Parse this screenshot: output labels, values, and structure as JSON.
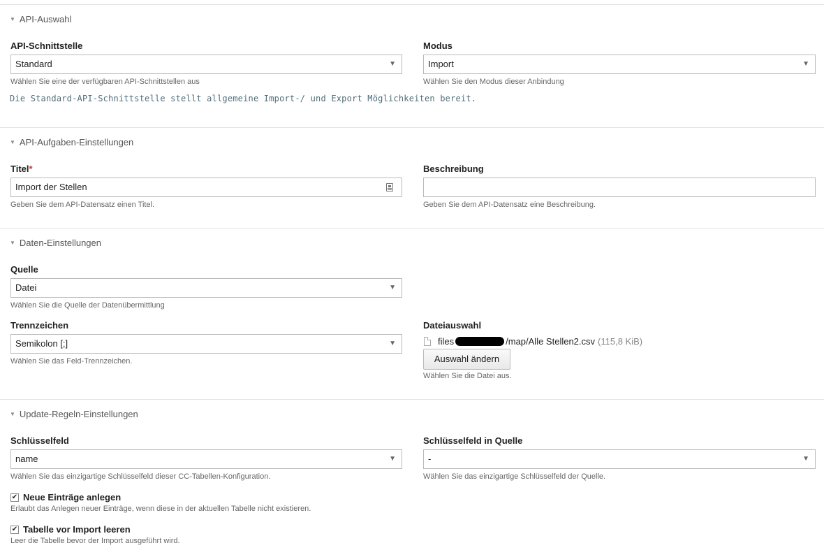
{
  "sections": {
    "api_auswahl": {
      "title": "API-Auswahl",
      "schnittstelle": {
        "label": "API-Schnittstelle",
        "value": "Standard",
        "help": "Wählen Sie eine der verfügbaren API-Schnittstellen aus"
      },
      "modus": {
        "label": "Modus",
        "value": "Import",
        "help": "Wählen Sie den Modus dieser Anbindung"
      },
      "description": "Die Standard-API-Schnittstelle stellt allgemeine Import-/ und Export Möglichkeiten bereit."
    },
    "aufgaben": {
      "title": "API-Aufgaben-Einstellungen",
      "titel": {
        "label": "Titel",
        "required_mark": "*",
        "value": "Import der Stellen",
        "help": "Geben Sie dem API-Datensatz einen Titel."
      },
      "beschreibung": {
        "label": "Beschreibung",
        "value": "",
        "help": "Geben Sie dem API-Datensatz eine Beschreibung."
      }
    },
    "daten": {
      "title": "Daten-Einstellungen",
      "quelle": {
        "label": "Quelle",
        "value": "Datei",
        "help": "Wählen Sie die Quelle der Datenübermittlung"
      },
      "trennzeichen": {
        "label": "Trennzeichen",
        "value": "Semikolon [;]",
        "help": "Wählen Sie das Feld-Trennzeichen."
      },
      "dateiauswahl": {
        "label": "Dateiauswahl",
        "file_prefix": "files",
        "file_suffix": "/map/Alle Stellen2.csv",
        "file_size": "(115,8 KiB)",
        "button": "Auswahl ändern",
        "help": "Wählen Sie die Datei aus."
      }
    },
    "update": {
      "title": "Update-Regeln-Einstellungen",
      "schluesselfeld": {
        "label": "Schlüsselfeld",
        "value": "name",
        "help": "Wählen Sie das einzigartige Schlüsselfeld dieser CC-Tabellen-Konfiguration."
      },
      "schluesselfeld_quelle": {
        "label": "Schlüsselfeld in Quelle",
        "value": "-",
        "help": "Wählen Sie das einzigartige Schlüsselfeld der Quelle."
      },
      "neue_eintraege": {
        "label": "Neue Einträge anlegen",
        "checked": true,
        "help": "Erlaubt das Anlegen neuer Einträge, wenn diese in der aktuellen Tabelle nicht existieren."
      },
      "tabelle_leeren": {
        "label": "Tabelle vor Import leeren",
        "checked": true,
        "help": "Leer die Tabelle bevor der Import ausgeführt wird."
      }
    }
  },
  "glyphs": {
    "collapse": "▼",
    "dropdown": "▼",
    "check": "✔"
  },
  "icons": [
    "collapse-triangle-icon",
    "dropdown-arrow-icon",
    "contact-card-icon",
    "file-icon",
    "checkmark-icon"
  ]
}
